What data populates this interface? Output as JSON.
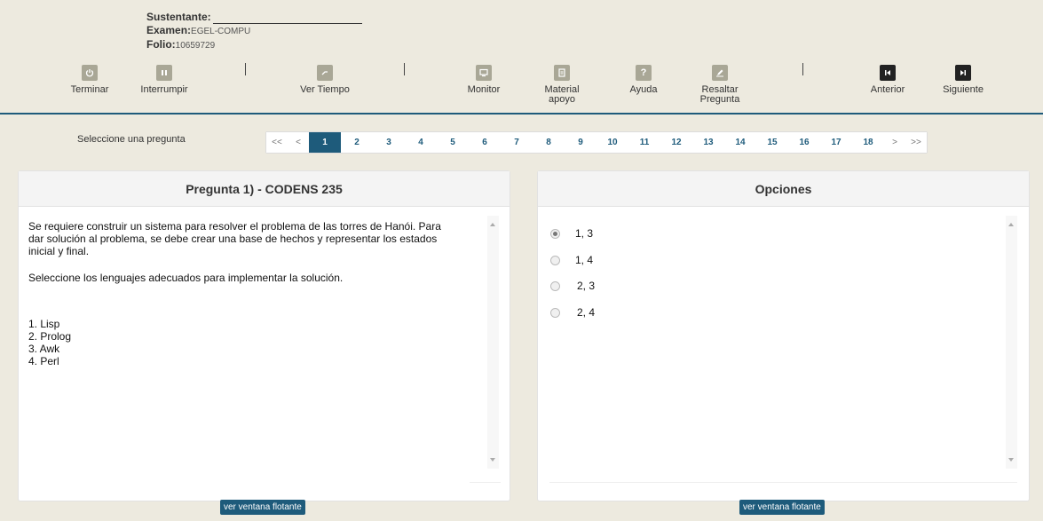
{
  "header": {
    "sustentante_label": "Sustentante:",
    "examen_label": "Examen:",
    "examen_value": "EGEL-COMPU",
    "folio_label": "Folio:",
    "folio_value": "10659729"
  },
  "toolbar": {
    "terminar": "Terminar",
    "interrumpir": "Interrumpir",
    "ver_tiempo": "Ver Tiempo",
    "monitor": "Monitor",
    "material_1": "Material",
    "material_2": "apoyo",
    "ayuda": "Ayuda",
    "resaltar_1": "Resaltar",
    "resaltar_2": "Pregunta",
    "anterior": "Anterior",
    "siguiente": "Siguiente",
    "separator": "|"
  },
  "pagination": {
    "label": "Seleccione una pregunta",
    "first": "<<",
    "prev": "<",
    "next": ">",
    "last": ">>",
    "pages": [
      "1",
      "2",
      "3",
      "4",
      "5",
      "6",
      "7",
      "8",
      "9",
      "10",
      "11",
      "12",
      "13",
      "14",
      "15",
      "16",
      "17",
      "18"
    ],
    "active": "1"
  },
  "question": {
    "title": "Pregunta 1) - CODENS 235",
    "paragraph1": "Se requiere construir un sistema para resolver el problema de las torres de Hanói. Para dar solución al problema, se debe crear una base de hechos y representar los estados inicial y final.",
    "paragraph2": "Seleccione los lenguajes adecuados para implementar la solución.",
    "items": [
      "1. Lisp",
      "2. Prolog",
      "3. Awk",
      "4. Perl"
    ]
  },
  "options": {
    "title": "Opciones",
    "choices": [
      "1, 3",
      "1, 4",
      "2, 3",
      "2, 4"
    ],
    "selected": 0
  },
  "buttons": {
    "float_left": "ver ventana flotante",
    "float_right": "ver ventana flotante"
  },
  "colors": {
    "accent": "#1e5b7b",
    "background": "#edeadf"
  }
}
